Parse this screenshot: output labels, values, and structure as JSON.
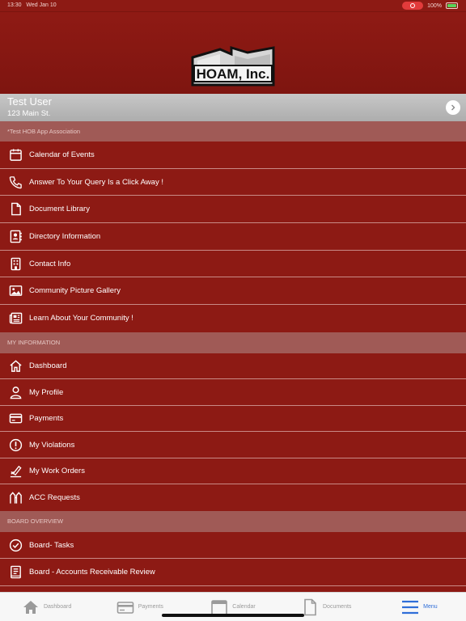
{
  "status_bar": {
    "time": "13:30",
    "date": "Wed Jan 10",
    "battery": "100%",
    "battery_level": 1.0
  },
  "logo": {
    "text": "HOAM, Inc."
  },
  "user": {
    "name": "Test User",
    "address": "123 Main St."
  },
  "sections": [
    {
      "header": "*Test HOB App Association",
      "items": [
        {
          "label": "Calendar of Events",
          "icon": "calendar-icon"
        },
        {
          "label": "Answer To Your Query Is a Click Away !",
          "icon": "phone-icon"
        },
        {
          "label": "Document Library",
          "icon": "document-icon"
        },
        {
          "label": "Directory Information",
          "icon": "contact-card-icon"
        },
        {
          "label": "Contact Info",
          "icon": "building-icon"
        },
        {
          "label": "Community Picture Gallery",
          "icon": "image-icon"
        },
        {
          "label": "Learn About Your Community !",
          "icon": "newspaper-icon"
        }
      ]
    },
    {
      "header": "MY INFORMATION",
      "items": [
        {
          "label": "Dashboard",
          "icon": "home-icon"
        },
        {
          "label": "My Profile",
          "icon": "person-icon"
        },
        {
          "label": "Payments",
          "icon": "credit-card-icon"
        },
        {
          "label": "My Violations",
          "icon": "alert-icon"
        },
        {
          "label": "My Work Orders",
          "icon": "work-order-icon"
        },
        {
          "label": "ACC Requests",
          "icon": "acc-request-icon"
        }
      ]
    },
    {
      "header": "BOARD OVERVIEW",
      "items": [
        {
          "label": "Board- Tasks",
          "icon": "check-circle-icon"
        },
        {
          "label": "Board - Accounts Receivable Review",
          "icon": "ledger-icon"
        }
      ]
    }
  ],
  "tabs": [
    {
      "label": "Dashboard",
      "icon": "home-icon"
    },
    {
      "label": "Payments",
      "icon": "credit-card-icon"
    },
    {
      "label": "Calendar",
      "icon": "calendar-icon"
    },
    {
      "label": "Documents",
      "icon": "document-icon"
    },
    {
      "label": "Menu",
      "icon": "menu-icon",
      "active": true
    }
  ],
  "colors": {
    "primary": "#8d1a14",
    "section": "#a05a56",
    "accent": "#2f6ed8"
  }
}
